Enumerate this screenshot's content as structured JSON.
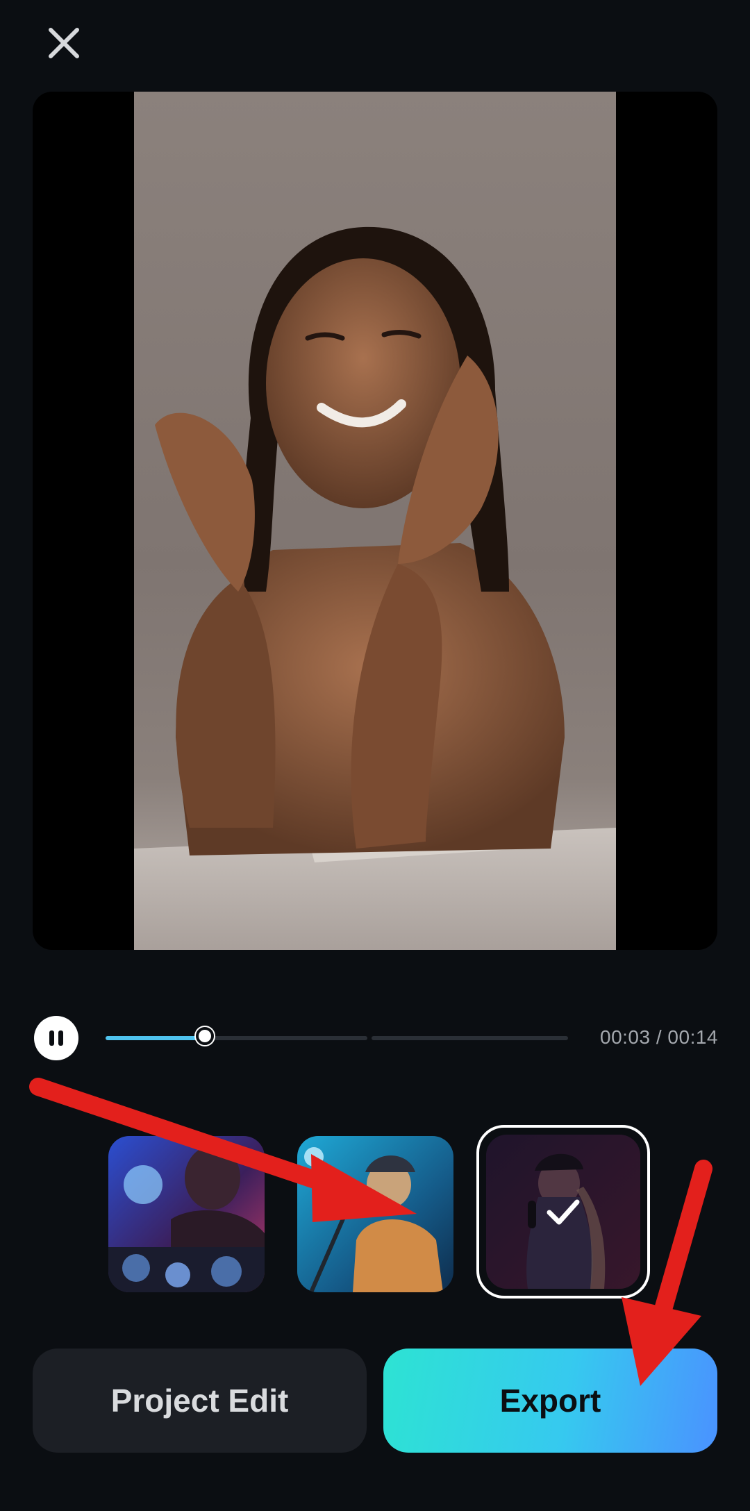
{
  "header": {
    "close_icon": "close-icon"
  },
  "player": {
    "current_time": "00:03",
    "separator": " / ",
    "total_time": "00:14",
    "progress_fraction": 0.214,
    "is_playing": true
  },
  "templates": [
    {
      "name": "dj-performer",
      "selected": false
    },
    {
      "name": "singer-with-microphone",
      "selected": false
    },
    {
      "name": "woman-with-cap-and-microphone",
      "selected": true
    }
  ],
  "actions": {
    "project_edit_label": "Project Edit",
    "export_label": "Export"
  },
  "colors": {
    "background": "#0b0e12",
    "progress": "#4fc3ee",
    "export_gradient_start": "#2de3d3",
    "export_gradient_end": "#4a92ff",
    "annotation_arrow": "#e3201c"
  }
}
